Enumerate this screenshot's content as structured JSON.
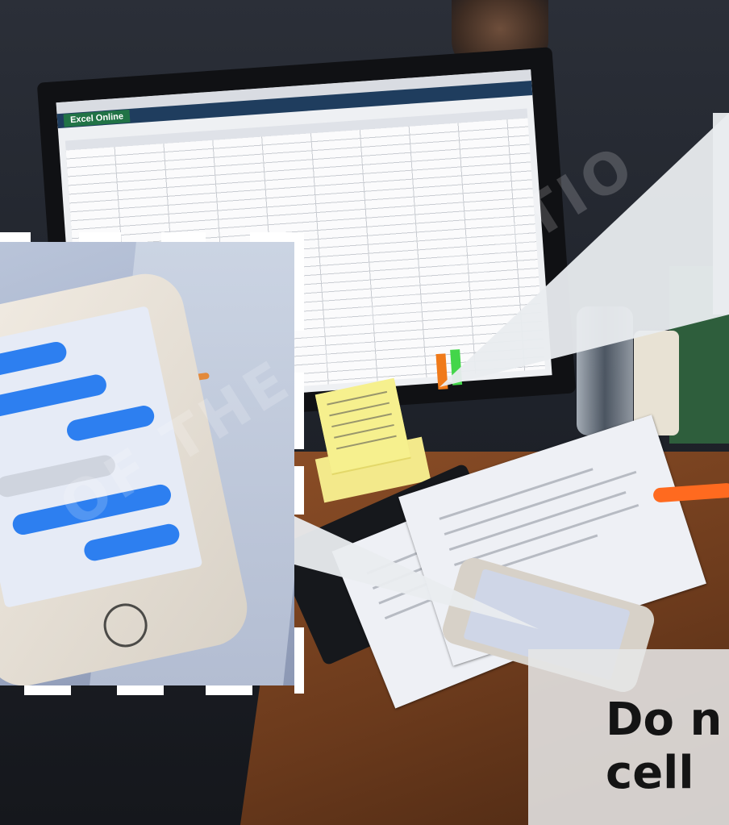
{
  "caption": {
    "text": "Do n\ncell"
  },
  "watermark": {
    "text": "THE NATIO",
    "text_2": "OF THE"
  },
  "screen": {
    "app_title": "Excel Online"
  },
  "colors": {
    "caption_background": "#e6e6e6",
    "caption_text": "#141414",
    "dash_frame": "#ffffff",
    "excel_green": "#217346",
    "sticker_orange": "#f07a1a",
    "sticker_green": "#43d64a",
    "highlighter": "#ff6a1f"
  }
}
